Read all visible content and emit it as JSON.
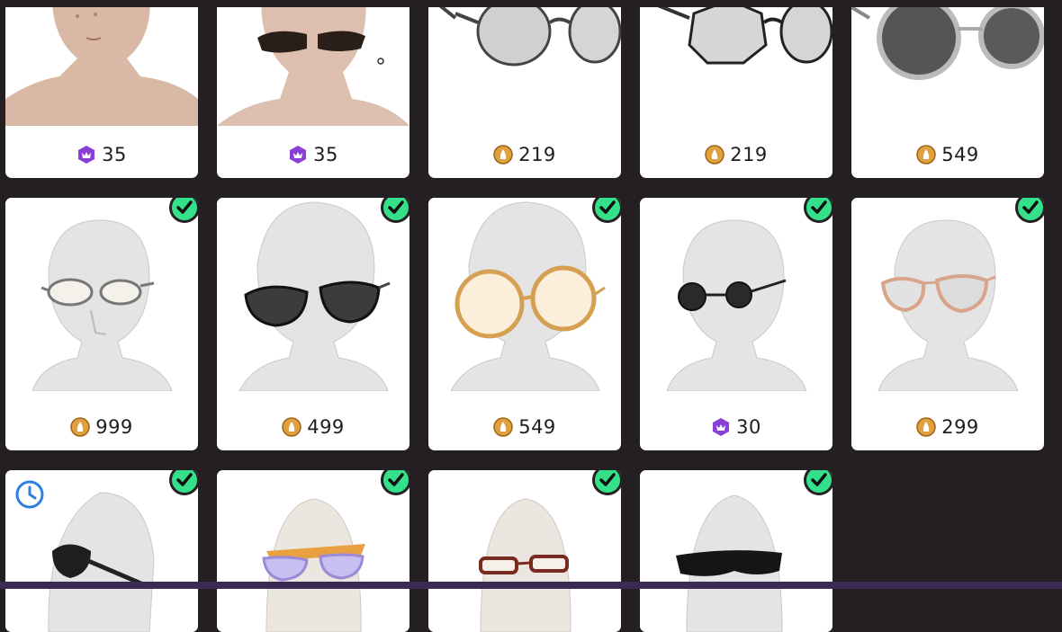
{
  "currencies": {
    "gold": {
      "icon": "gold-coin-icon",
      "color": "#e0a040"
    },
    "premium": {
      "icon": "premium-gem-icon",
      "color": "#8a3fd6"
    }
  },
  "items": [
    {
      "price": "35",
      "currency": "premium",
      "owned": false,
      "timed": false,
      "art": "skin-face"
    },
    {
      "price": "35",
      "currency": "premium",
      "owned": false,
      "timed": false,
      "art": "skin-face-shades"
    },
    {
      "price": "219",
      "currency": "gold",
      "owned": false,
      "timed": false,
      "art": "grey-round-glasses"
    },
    {
      "price": "219",
      "currency": "gold",
      "owned": false,
      "timed": false,
      "art": "grey-round-glasses-2"
    },
    {
      "price": "549",
      "currency": "gold",
      "owned": false,
      "timed": false,
      "art": "silver-round-shades"
    },
    {
      "price": "999",
      "currency": "gold",
      "owned": true,
      "timed": false,
      "art": "thin-clear-glasses"
    },
    {
      "price": "499",
      "currency": "gold",
      "owned": true,
      "timed": false,
      "art": "black-cat-eye-shades"
    },
    {
      "price": "549",
      "currency": "gold",
      "owned": true,
      "timed": false,
      "art": "gold-round-glasses"
    },
    {
      "price": "30",
      "currency": "premium",
      "owned": true,
      "timed": false,
      "art": "small-black-round-glasses"
    },
    {
      "price": "299",
      "currency": "gold",
      "owned": true,
      "timed": false,
      "art": "rose-gold-mirror-glasses"
    },
    {
      "price": "",
      "currency": "",
      "owned": true,
      "timed": true,
      "art": "eye-patch"
    },
    {
      "price": "",
      "currency": "",
      "owned": true,
      "timed": false,
      "art": "purple-aviator-shades"
    },
    {
      "price": "",
      "currency": "",
      "owned": true,
      "timed": false,
      "art": "brown-rectangle-glasses"
    },
    {
      "price": "",
      "currency": "",
      "owned": true,
      "timed": false,
      "art": "black-wrap-shades"
    }
  ]
}
